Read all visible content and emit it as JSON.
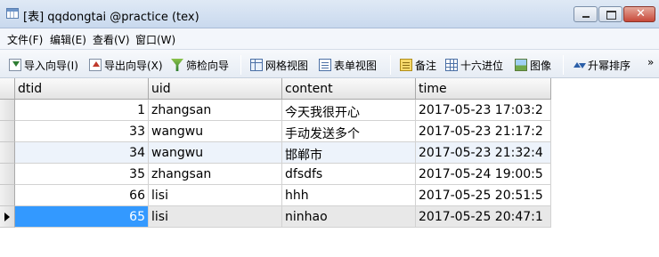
{
  "window": {
    "title": "[表] qqdongtai @practice (tex)"
  },
  "menu": [
    {
      "label": "文件(F)"
    },
    {
      "label": "编辑(E)"
    },
    {
      "label": "查看(V)"
    },
    {
      "label": "窗口(W)"
    }
  ],
  "toolbar": {
    "import_wizard": "导入向导(I)",
    "export_wizard": "导出向导(X)",
    "filter_wizard": "筛检向导",
    "grid_view": "网格视图",
    "form_view": "表单视图",
    "memo": "备注",
    "hex": "十六进位",
    "image": "图像",
    "sort_asc": "升幂排序",
    "overflow": "»"
  },
  "table": {
    "columns": [
      "dtid",
      "uid",
      "content",
      "time"
    ],
    "rows": [
      {
        "dtid": "1",
        "uid": "zhangsan",
        "content": "今天我很开心",
        "time": "2017-05-23 17:03:2"
      },
      {
        "dtid": "33",
        "uid": "wangwu",
        "content": "手动发送多个",
        "time": "2017-05-23 21:17:2"
      },
      {
        "dtid": "34",
        "uid": "wangwu",
        "content": "邯郸市",
        "time": "2017-05-23 21:32:4"
      },
      {
        "dtid": "35",
        "uid": "zhangsan",
        "content": "dfsdfs",
        "time": "2017-05-24 19:00:5"
      },
      {
        "dtid": "66",
        "uid": "lisi",
        "content": "hhh",
        "time": "2017-05-25 20:51:5"
      },
      {
        "dtid": "65",
        "uid": "lisi",
        "content": "ninhao",
        "time": "2017-05-25 20:47:1"
      }
    ],
    "selected_row": 5,
    "selected_column": "dtid"
  },
  "colors": {
    "selection": "#3399ff",
    "alt_row": "#edf3fb",
    "header": "#e4e4e4"
  }
}
